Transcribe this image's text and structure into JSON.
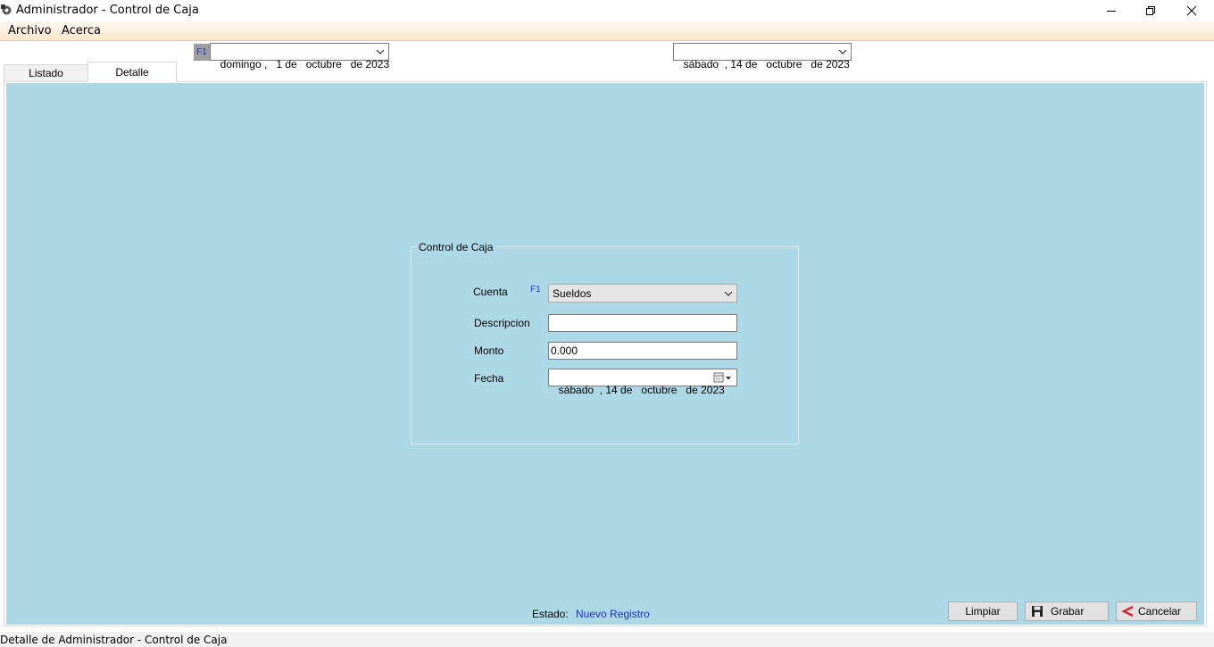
{
  "window": {
    "title": "Administrador - Control de Caja",
    "icons": {
      "app": "app-gear-icon",
      "minimize": "minimize-icon",
      "restore": "restore-icon",
      "close": "close-icon"
    }
  },
  "menu": {
    "items": [
      "Archivo",
      "Acerca"
    ]
  },
  "filters": {
    "f1_badge": "F1",
    "date_from": "domingo ,   1 de   octubre   de 2023",
    "date_to": "sábado  , 14 de   octubre   de 2023"
  },
  "tabs": [
    "Listado",
    "Detalle"
  ],
  "active_tab": "Detalle",
  "form": {
    "group_title": "Control de Caja",
    "cuenta_label": "Cuenta",
    "cuenta_hotkey": "F1",
    "cuenta_value": "Sueldos",
    "descripcion_label": "Descripcion",
    "descripcion_value": "",
    "monto_label": "Monto",
    "monto_value": "0.000",
    "fecha_label": "Fecha",
    "fecha_value": "sábado  , 14 de   octubre   de 2023"
  },
  "estado": {
    "label": "Estado:",
    "value": "Nuevo Registro"
  },
  "buttons": {
    "limpiar": "Limpiar",
    "grabar": "Grabar",
    "cancelar": "Cancelar"
  },
  "status_bar": {
    "text": "Detalle de Administrador - Control de Caja"
  },
  "colors": {
    "panel_bg": "#add8e6",
    "accent_blue": "#1a2fd6",
    "menu_gradient_end": "#fbe6cf",
    "cancel_arrow": "#d8282e"
  }
}
